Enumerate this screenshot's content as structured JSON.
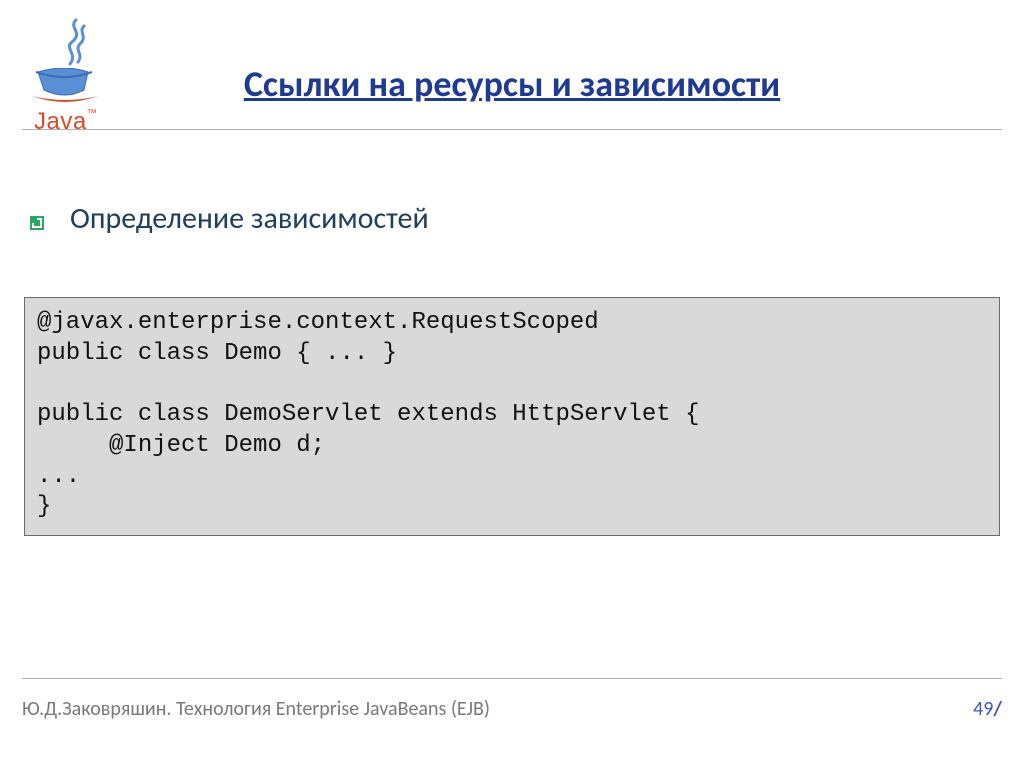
{
  "logo_text": "Java",
  "title": "Ссылки на ресурсы и зависимости",
  "bullet": "Определение зависимостей",
  "code": "@javax.enterprise.context.RequestScoped\npublic class Demo { ... }\n\npublic class DemoServlet extends HttpServlet {\n     @Inject Demo d;\n...\n}",
  "footer_text": "Ю.Д.Заковряшин. Технология Enterprise JavaBeans (EJB)",
  "page": "49",
  "slash": "/"
}
